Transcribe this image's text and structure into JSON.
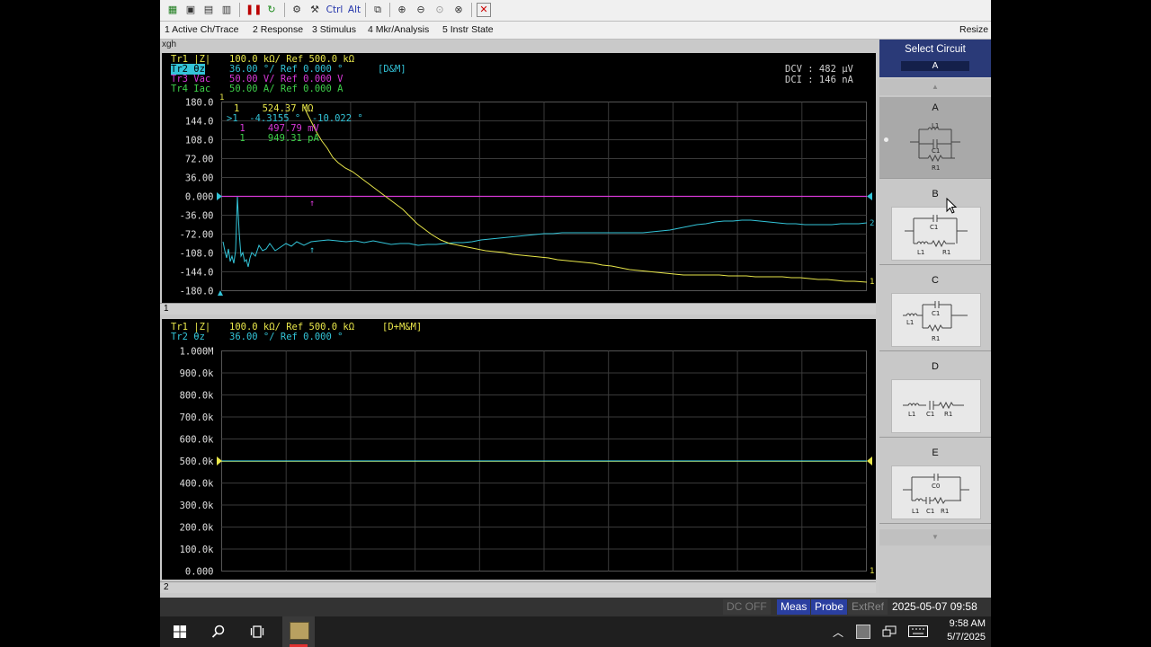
{
  "menu": {
    "items": [
      "1 Active Ch/Trace",
      "2 Response",
      "3 Stimulus",
      "4 Mkr/Analysis",
      "5 Instr State"
    ],
    "resize": "Resize"
  },
  "toolbar": {
    "icons": [
      "windows-icon",
      "save-icon",
      "save-as-icon",
      "print-icon",
      "pause-icon",
      "refresh-icon",
      "trigger-icon",
      "recall-icon",
      "ctrl",
      "alt",
      "copy-icon",
      "zoom-in-icon",
      "zoom-out-icon",
      "zoom-fit-icon",
      "zoom-area-icon",
      "fullscreen-icon"
    ],
    "ctrl_label": "Ctrl",
    "alt_label": "Alt"
  },
  "channel_label": "xgh",
  "ch1": {
    "traces": [
      {
        "name": "Tr1 |Z|",
        "scale": "100.0 kΩ/ Ref 500.0 kΩ",
        "color": "#e8e64a"
      },
      {
        "name": "Tr2 θz",
        "scale": "36.00 °/ Ref 0.000 °",
        "tag": "[D&M]",
        "color": "#33c4d8"
      },
      {
        "name": "Tr3 Vac",
        "scale": "50.00 V/ Ref 0.000 V",
        "color": "#d838d8"
      },
      {
        "name": "Tr4 Iac",
        "scale": "50.00 A/ Ref 0.000 A",
        "color": "#3ed04a"
      }
    ],
    "dcv": "DCV : 482 μV",
    "dci": "DCI : 146 nA",
    "y_ticks": [
      "180.0",
      "144.0",
      "108.0",
      "72.00",
      "36.00",
      "0.000",
      "-36.00",
      "-72.00",
      "-108.0",
      "-144.0",
      "-180.0"
    ],
    "markers": [
      {
        "text": "1    524.37 MΩ",
        "color": "#e8e64a"
      },
      {
        "text": ">1  -4.3155 °  -10.022 °",
        "color": "#33c4d8"
      },
      {
        "text": " 1    497.79 mV",
        "color": "#d838d8"
      },
      {
        "text": " 1    949.31 pA",
        "color": "#3ed04a"
      }
    ],
    "index": "1"
  },
  "ch2": {
    "traces": [
      {
        "name": "Tr1 |Z|",
        "scale": "100.0 kΩ/ Ref 500.0 kΩ",
        "tag": "[D+M&M]",
        "color": "#e8e64a"
      },
      {
        "name": "Tr2 θz",
        "scale": "36.00 °/ Ref 0.000 °",
        "color": "#33c4d8"
      }
    ],
    "y_ticks": [
      "1.000M",
      "900.0k",
      "800.0k",
      "700.0k",
      "600.0k",
      "500.0k",
      "400.0k",
      "300.0k",
      "200.0k",
      "100.0k",
      "0.000"
    ],
    "index": "2"
  },
  "select_circuit": {
    "title": "Select Circuit",
    "value": "A",
    "circuits": [
      {
        "label": "A",
        "selected": true
      },
      {
        "label": "B",
        "selected": false
      },
      {
        "label": "C",
        "selected": false
      },
      {
        "label": "D",
        "selected": false
      },
      {
        "label": "E",
        "selected": false
      }
    ]
  },
  "status": {
    "dc": "DC OFF",
    "meas": "Meas",
    "probe": "Probe",
    "extref": "ExtRef",
    "datetime": "2025-05-07 09:58"
  },
  "taskbar": {
    "time": "9:58 AM",
    "date": "5/7/2025"
  }
}
